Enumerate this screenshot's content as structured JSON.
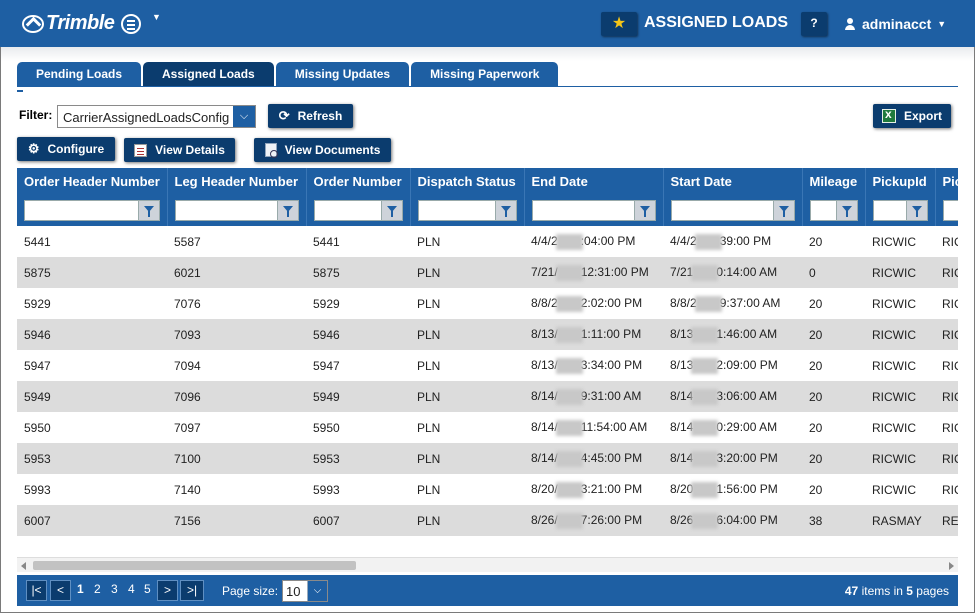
{
  "header": {
    "logo": "Trimble",
    "title": "ASSIGNED LOADS",
    "help_label": "?",
    "user": "adminacct"
  },
  "tabs": [
    {
      "label": "Pending Loads",
      "active": false
    },
    {
      "label": "Assigned Loads",
      "active": true
    },
    {
      "label": "Missing Updates",
      "active": false
    },
    {
      "label": "Missing Paperwork",
      "active": false
    }
  ],
  "toolbar": {
    "filter_label": "Filter:",
    "filter_value": "CarrierAssignedLoadsConfig",
    "refresh_label": "Refresh",
    "export_label": "Export",
    "configure_label": "Configure",
    "view_details_label": "View Details",
    "view_documents_label": "View Documents"
  },
  "grid": {
    "columns": [
      "Order Header Number",
      "Leg Header Number",
      "Order Number",
      "Dispatch Status",
      "End Date",
      "Start Date",
      "Mileage",
      "PickupId",
      "PickupCity"
    ],
    "rows": [
      {
        "order_header": "5441",
        "leg_header": "5587",
        "order_number": "5441",
        "status": "PLN",
        "end_pre": "4/4/2",
        "end_post": ":04:00 PM",
        "start_pre": "4/4/2",
        "start_post": "39:00 PM",
        "mileage": "20",
        "pickup_id": "RICWIC",
        "pickup_city": "RIC"
      },
      {
        "order_header": "5875",
        "leg_header": "6021",
        "order_number": "5875",
        "status": "PLN",
        "end_pre": "7/21/",
        "end_post": "12:31:00 PM",
        "start_pre": "7/21",
        "start_post": "0:14:00 AM",
        "mileage": "0",
        "pickup_id": "RICWIC",
        "pickup_city": "RIC"
      },
      {
        "order_header": "5929",
        "leg_header": "7076",
        "order_number": "5929",
        "status": "PLN",
        "end_pre": "8/8/2",
        "end_post": "2:02:00 PM",
        "start_pre": "8/8/2",
        "start_post": "9:37:00 AM",
        "mileage": "20",
        "pickup_id": "RICWIC",
        "pickup_city": "RIC"
      },
      {
        "order_header": "5946",
        "leg_header": "7093",
        "order_number": "5946",
        "status": "PLN",
        "end_pre": "8/13/",
        "end_post": "1:11:00 PM",
        "start_pre": "8/13",
        "start_post": "1:46:00 AM",
        "mileage": "20",
        "pickup_id": "RICWIC",
        "pickup_city": "RIC"
      },
      {
        "order_header": "5947",
        "leg_header": "7094",
        "order_number": "5947",
        "status": "PLN",
        "end_pre": "8/13/",
        "end_post": "3:34:00 PM",
        "start_pre": "8/13",
        "start_post": "2:09:00 PM",
        "mileage": "20",
        "pickup_id": "RICWIC",
        "pickup_city": "RIC"
      },
      {
        "order_header": "5949",
        "leg_header": "7096",
        "order_number": "5949",
        "status": "PLN",
        "end_pre": "8/14/",
        "end_post": "9:31:00 AM",
        "start_pre": "8/14",
        "start_post": "3:06:00 AM",
        "mileage": "20",
        "pickup_id": "RICWIC",
        "pickup_city": "RIC"
      },
      {
        "order_header": "5950",
        "leg_header": "7097",
        "order_number": "5950",
        "status": "PLN",
        "end_pre": "8/14/",
        "end_post": "11:54:00 AM",
        "start_pre": "8/14",
        "start_post": "0:29:00 AM",
        "mileage": "20",
        "pickup_id": "RICWIC",
        "pickup_city": "RIC"
      },
      {
        "order_header": "5953",
        "leg_header": "7100",
        "order_number": "5953",
        "status": "PLN",
        "end_pre": "8/14/",
        "end_post": "4:45:00 PM",
        "start_pre": "8/14",
        "start_post": "3:20:00 PM",
        "mileage": "20",
        "pickup_id": "RICWIC",
        "pickup_city": "RIC"
      },
      {
        "order_header": "5993",
        "leg_header": "7140",
        "order_number": "5993",
        "status": "PLN",
        "end_pre": "8/20/",
        "end_post": "3:21:00 PM",
        "start_pre": "8/20",
        "start_post": "1:56:00 PM",
        "mileage": "20",
        "pickup_id": "RICWIC",
        "pickup_city": "RIC"
      },
      {
        "order_header": "6007",
        "leg_header": "7156",
        "order_number": "6007",
        "status": "PLN",
        "end_pre": "8/26/",
        "end_post": "7:26:00 PM",
        "start_pre": "8/26",
        "start_post": "6:04:00 PM",
        "mileage": "38",
        "pickup_id": "RASMAY",
        "pickup_city": "RE"
      }
    ]
  },
  "pager": {
    "first": "|<",
    "prev": "<",
    "pages": [
      "1",
      "2",
      "3",
      "4",
      "5"
    ],
    "current_page": "1",
    "next": ">",
    "last": ">|",
    "page_size_label": "Page size:",
    "page_size": "10",
    "total_items": "47",
    "items_in": "items in",
    "total_pages": "5",
    "pages_word": "pages"
  },
  "colors": {
    "primary": "#1e5fa3",
    "dark": "#0b3c6e",
    "row_alt": "#dcdcdc",
    "star": "#f5c518"
  },
  "icons": [
    "trimble-logo-icon",
    "hamburger-menu-icon",
    "star-icon",
    "user-icon",
    "refresh-icon",
    "gear-icon",
    "excel-icon",
    "view-details-icon",
    "view-documents-icon",
    "filter-funnel-icon"
  ]
}
